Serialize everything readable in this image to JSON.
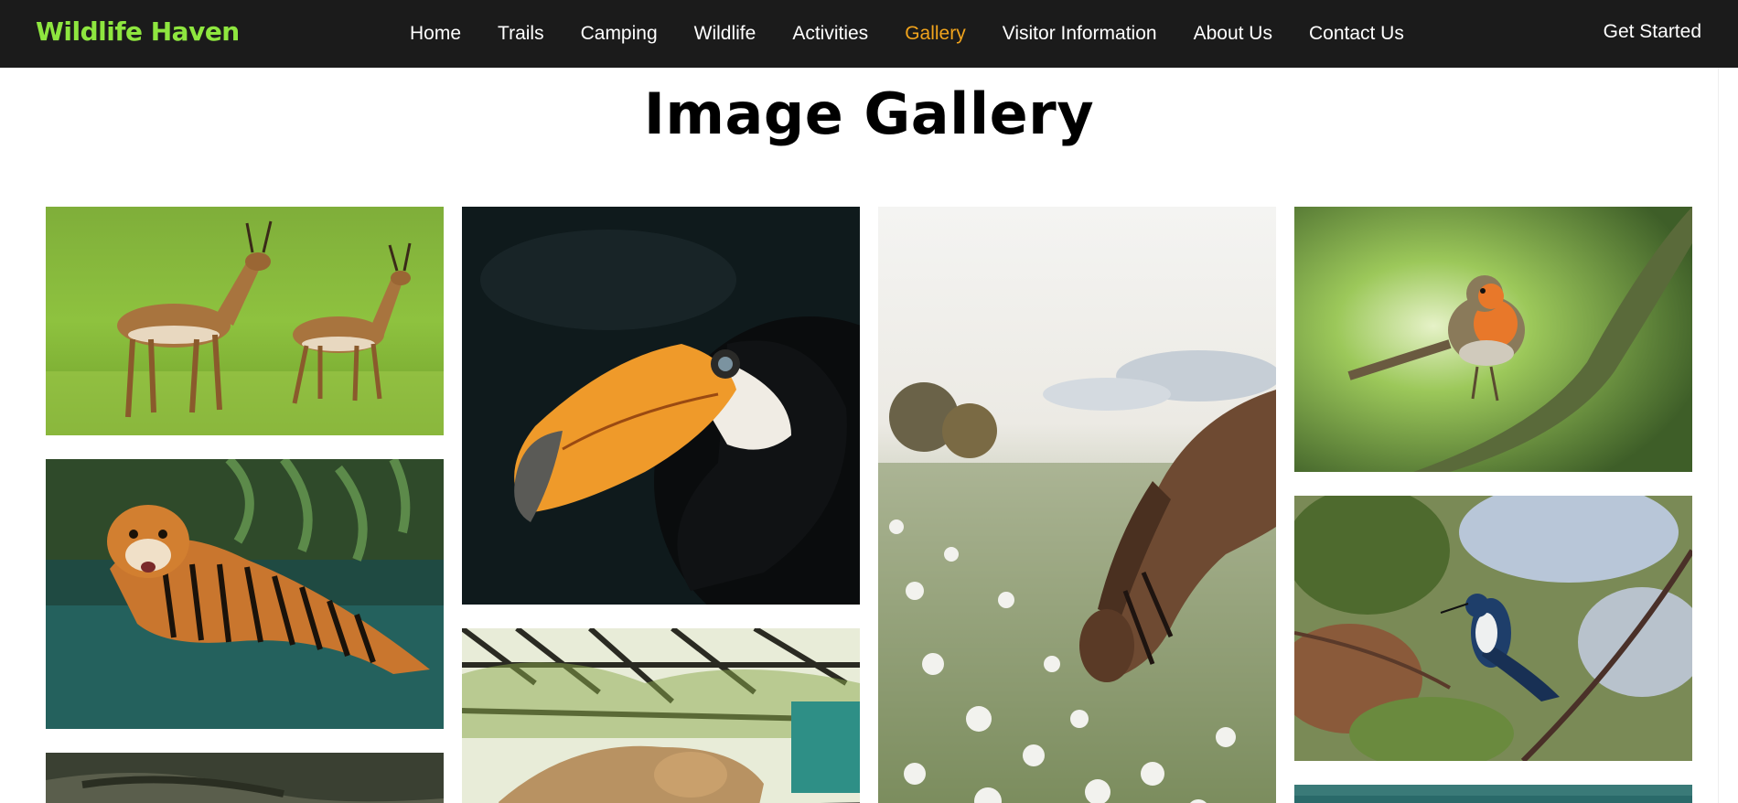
{
  "navbar": {
    "brand": "Wildlife Haven",
    "links": [
      {
        "label": "Home"
      },
      {
        "label": "Trails"
      },
      {
        "label": "Camping"
      },
      {
        "label": "Wildlife"
      },
      {
        "label": "Activities"
      },
      {
        "label": "Gallery",
        "active": true
      },
      {
        "label": "Visitor Information"
      },
      {
        "label": "About Us"
      },
      {
        "label": "Contact Us"
      }
    ],
    "cta": "Get Started",
    "active_color": "#f0a31c",
    "brand_color": "#8ee63f",
    "background": "#1b1b1b"
  },
  "main": {
    "title": "Image Gallery"
  },
  "gallery": {
    "columns": [
      {
        "images": [
          {
            "subject": "antelope-image"
          },
          {
            "subject": "tiger-image"
          },
          {
            "subject": "crocodile-image"
          }
        ]
      },
      {
        "images": [
          {
            "subject": "toucan-image"
          },
          {
            "subject": "lioness-image"
          }
        ]
      },
      {
        "images": [
          {
            "subject": "horse-image"
          }
        ]
      },
      {
        "images": [
          {
            "subject": "robin-image"
          },
          {
            "subject": "hummingbird-image"
          },
          {
            "subject": "bird-image"
          }
        ]
      }
    ]
  }
}
